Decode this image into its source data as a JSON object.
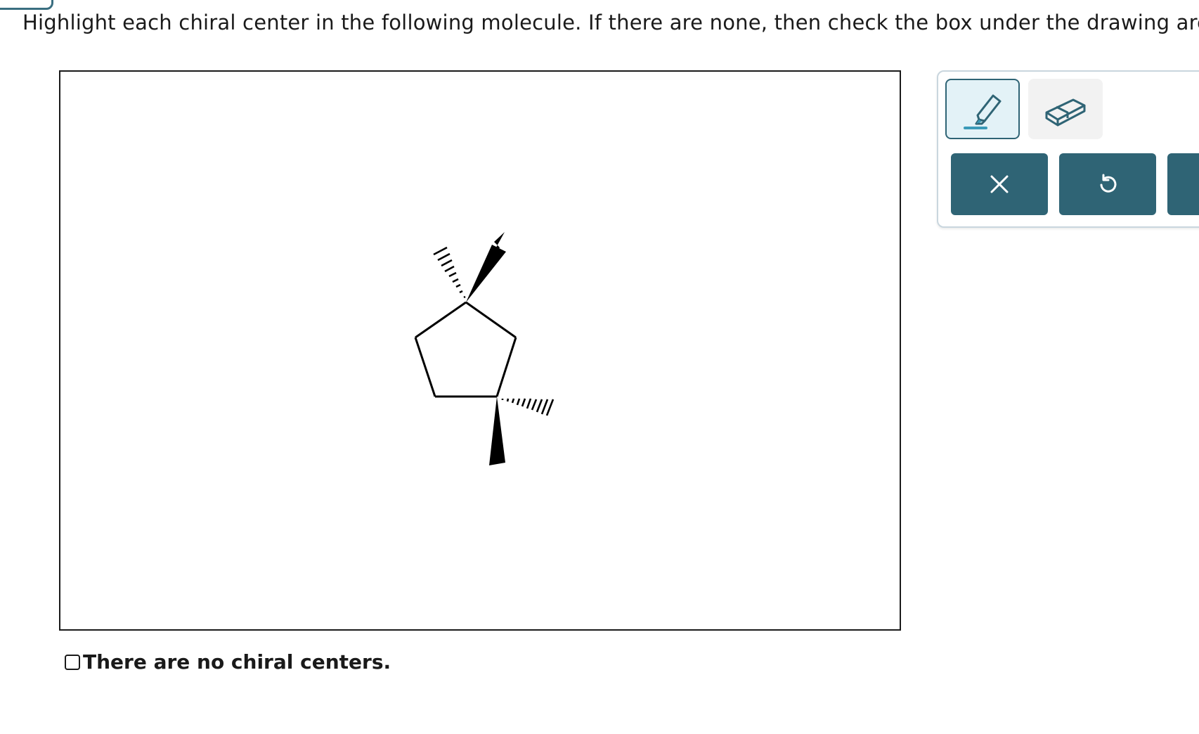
{
  "prompt": "Highlight each chiral center in the following molecule. If there are none, then check the box under the drawing area.",
  "tools": {
    "highlight": {
      "icon": "highlighter-icon",
      "selected": true
    },
    "eraser": {
      "icon": "eraser-icon",
      "selected": false
    }
  },
  "actions": {
    "clear": {
      "icon": "close-icon"
    },
    "undo": {
      "icon": "undo-icon"
    }
  },
  "no_chiral_checkbox": {
    "label": "There are no chiral centers.",
    "checked": false
  },
  "colors": {
    "accent": "#2f6475",
    "tool_selected_bg": "#e3f2f7",
    "tool_bg": "#f2f2f2",
    "highlighter_tip": "#3a9ab8"
  },
  "molecule": {
    "ring": "cyclopentane",
    "substituents": [
      "methyl",
      "methyl",
      "methyl",
      "methyl"
    ],
    "bond_styles": [
      "hashed-wedge",
      "solid-wedge",
      "hashed-wedge",
      "solid-wedge"
    ]
  }
}
